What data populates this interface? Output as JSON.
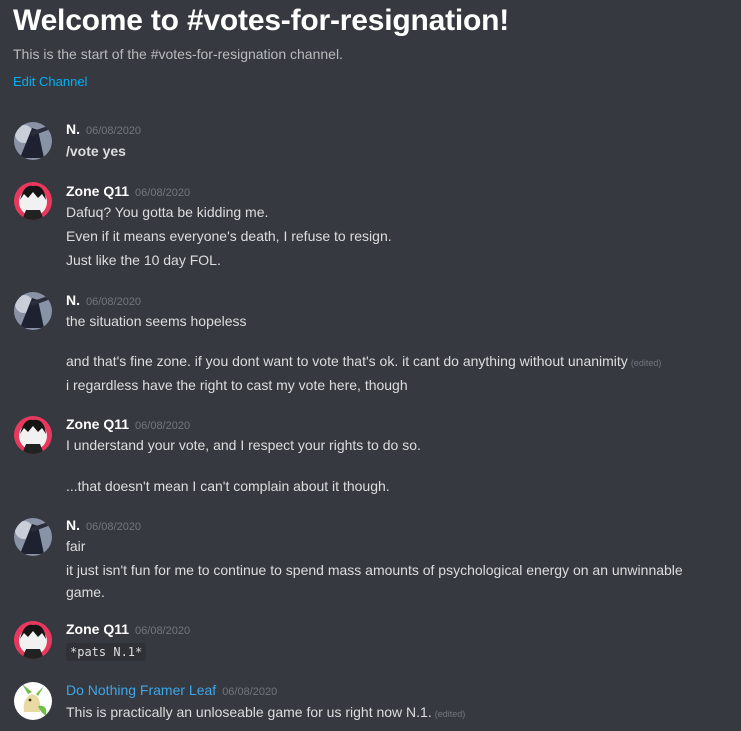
{
  "channel": {
    "welcome_title": "Welcome to #votes-for-resignation!",
    "start_text": "This is the start of the #votes-for-resignation channel.",
    "edit_label": "Edit Channel"
  },
  "messages": [
    {
      "author": "N.",
      "timestamp": "06/08/2020",
      "avatar": "dark-figure-avatar",
      "lines": [
        "/vote yes"
      ]
    },
    {
      "author": "Zone Q11",
      "timestamp": "06/08/2020",
      "avatar": "anime-character-avatar",
      "lines": [
        "Dafuq? You gotta be kidding me.",
        "Even if it means everyone's death, I refuse to resign.",
        "Just like the 10 day FOL."
      ]
    },
    {
      "author": "N.",
      "timestamp": "06/08/2020",
      "avatar": "dark-figure-avatar",
      "lines": [
        "the situation seems hopeless",
        "and that's fine zone. if you dont want to vote that's ok. it cant do anything without unanimity",
        "i regardless have the right to cast my vote here, though"
      ]
    },
    {
      "author": "Zone Q11",
      "timestamp": "06/08/2020",
      "avatar": "anime-character-avatar",
      "lines": [
        "I understand your vote, and I respect your rights to do so.",
        "...that doesn't mean I can't complain about it though."
      ]
    },
    {
      "author": "N.",
      "timestamp": "06/08/2020",
      "avatar": "dark-figure-avatar",
      "lines": [
        "fair",
        "it just isn't fun for me to continue to spend mass amounts of psychological energy on an unwinnable game."
      ]
    },
    {
      "author": "Zone Q11",
      "timestamp": "06/08/2020",
      "avatar": "anime-character-avatar",
      "lines": [
        "*pats N.1*"
      ]
    },
    {
      "author": "Do Nothing Framer Leaf",
      "timestamp": "06/08/2020",
      "avatar": "leafeon-avatar",
      "lines": [
        "This is practically an unloseable game for us right now N.1."
      ]
    }
  ],
  "edited_label": "(edited)",
  "colors": {
    "background": "#36393f",
    "link": "#00b0f4",
    "author_blue": "#3fa6e8",
    "zone_avatar_bg": "#e8385e"
  }
}
